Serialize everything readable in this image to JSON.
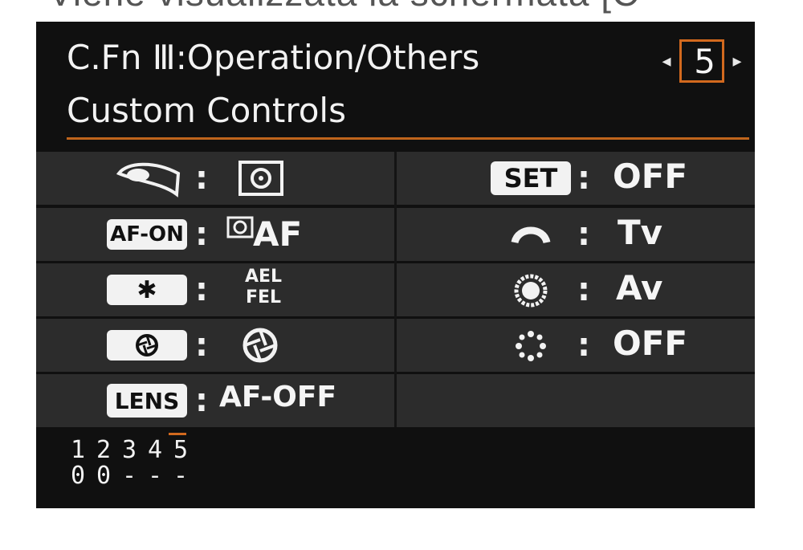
{
  "caption": "Viene visualizzata la schermata [C",
  "header": {
    "title": "C.Fn Ⅲ:Operation/Others",
    "subtitle": "Custom Controls",
    "page_number": "5",
    "prev_arrow": "◂",
    "next_arrow": "▸"
  },
  "left": [
    {
      "control": "shutter-button-half-press",
      "colon": ":",
      "value_icon": "metering-icon"
    },
    {
      "control": "AF-ON",
      "colon": ":",
      "value": "AF",
      "value_icon": "metering-af-icon"
    },
    {
      "control": "✱",
      "colon": ":",
      "value_top": "AEL",
      "value_bottom": "FEL"
    },
    {
      "control": "depth-of-field-preview",
      "colon": ":",
      "value_icon": "aperture-icon"
    },
    {
      "control": "LENS",
      "colon": ":",
      "value": "AF-OFF"
    }
  ],
  "right": [
    {
      "control": "SET",
      "colon": ":",
      "value": "OFF"
    },
    {
      "control": "main-dial-icon",
      "colon": ":",
      "value": "Tv"
    },
    {
      "control": "quick-control-dial-icon",
      "colon": ":",
      "value": "Av"
    },
    {
      "control": "multi-controller-icon",
      "colon": ":",
      "value": "OFF"
    }
  ],
  "status": {
    "numbers": [
      "1",
      "2",
      "3",
      "4",
      "5"
    ],
    "values": [
      "0",
      "0",
      "-",
      "-",
      "-"
    ]
  },
  "colors": {
    "accent": "#d2691e",
    "background": "#101010",
    "row": "#2c2c2c",
    "text": "#f2f2f2"
  }
}
